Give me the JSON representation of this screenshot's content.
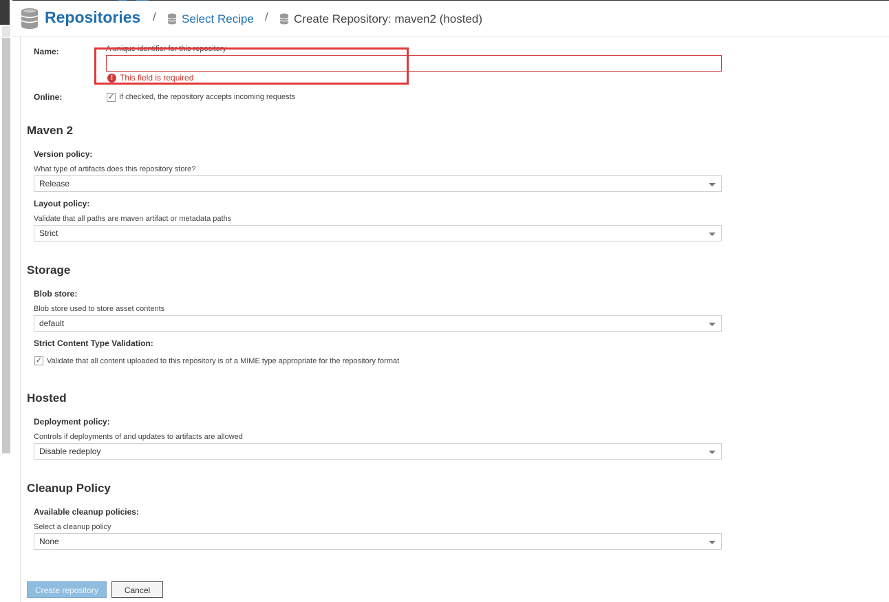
{
  "breadcrumb": {
    "root_label": "Repositories",
    "separator": "/",
    "step_label": "Select Recipe",
    "current_label": "Create Repository: maven2 (hosted)"
  },
  "name_field": {
    "label": "Name:",
    "help": "A unique identifier for this repository",
    "value": "",
    "error": "This field is required",
    "error_icon": "!"
  },
  "online": {
    "label": "Online:",
    "checked": true,
    "help": "If checked, the repository accepts incoming requests"
  },
  "maven": {
    "section_title": "Maven 2",
    "version_policy": {
      "label": "Version policy:",
      "help": "What type of artifacts does this repository store?",
      "value": "Release"
    },
    "layout_policy": {
      "label": "Layout policy:",
      "help": "Validate that all paths are maven artifact or metadata paths",
      "value": "Strict"
    }
  },
  "storage": {
    "section_title": "Storage",
    "blob_store": {
      "label": "Blob store:",
      "help": "Blob store used to store asset contents",
      "value": "default"
    },
    "strict_validation": {
      "label": "Strict Content Type Validation:",
      "checked": true,
      "help": "Validate that all content uploaded to this repository is of a MIME type appropriate for the repository format"
    }
  },
  "hosted": {
    "section_title": "Hosted",
    "deployment_policy": {
      "label": "Deployment policy:",
      "help": "Controls if deployments of and updates to artifacts are allowed",
      "value": "Disable redeploy"
    }
  },
  "cleanup": {
    "section_title": "Cleanup Policy",
    "policies": {
      "label": "Available cleanup policies:",
      "help": "Select a cleanup policy",
      "value": "None"
    }
  },
  "buttons": {
    "create_label": "Create repository",
    "cancel_label": "Cancel"
  },
  "check_glyph": "✓",
  "icons": {
    "repository": "database-icon",
    "error": "exclamation-circle-icon",
    "dropdown": "caret-down-icon"
  },
  "colors": {
    "link": "#1f6fb0",
    "error": "#c9302c",
    "annotation": "#e0393b",
    "primary_disabled": "#8fbde0"
  }
}
